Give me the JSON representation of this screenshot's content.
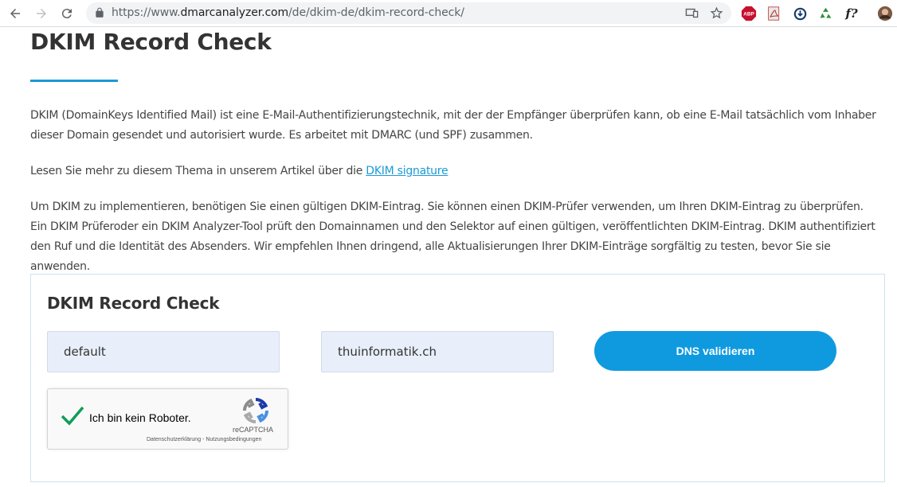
{
  "browser": {
    "url_prefix": "https://www.",
    "url_host": "dmarcanalyzer.com",
    "url_path": "/de/dkim-de/dkim-record-check/",
    "extensions": {
      "abp_label": "ABP",
      "formula_label": "f?"
    }
  },
  "page": {
    "title": "DKIM Record Check",
    "para1": "DKIM (DomainKeys Identified Mail) ist eine E-Mail-Authentifizierungstechnik, mit der der Empfänger überprüfen kann, ob eine E-Mail tatsächlich vom Inhaber dieser Domain gesendet und autorisiert wurde. Es arbeitet mit DMARC (und SPF) zusammen.",
    "para2_text": "Lesen Sie mehr zu diesem Thema in unserem Artikel über die ",
    "para2_link": "DKIM signature",
    "para3": "Um DKIM zu implementieren, benötigen Sie einen gültigen DKIM-Eintrag. Sie können einen DKIM-Prüfer verwenden, um Ihren DKIM-Eintrag zu überprüfen. Ein DKIM Prüferoder ein DKIM Analyzer-Tool prüft den Domainnamen und den Selektor auf einen gültigen, veröffentlichten DKIM-Eintrag. DKIM authentifiziert den Ruf und die Identität des Absenders. Wir empfehlen Ihnen dringend, alle Aktualisierungen Ihrer DKIM-Einträge sorgfältig zu testen, bevor Sie sie anwenden."
  },
  "checker": {
    "title": "DKIM Record Check",
    "selector_value": "default",
    "domain_value": "thuinformatik.ch",
    "button_label": "DNS validieren",
    "recaptcha": {
      "label": "Ich bin kein Roboter.",
      "brand": "reCAPTCHA",
      "links": "Datenschutzerklärung - Nutzungsbedingungen"
    }
  },
  "colors": {
    "accent": "#1c9ad6",
    "button": "#0f9ae0",
    "field_bg": "#e8effb",
    "check_green": "#0f9d58"
  }
}
